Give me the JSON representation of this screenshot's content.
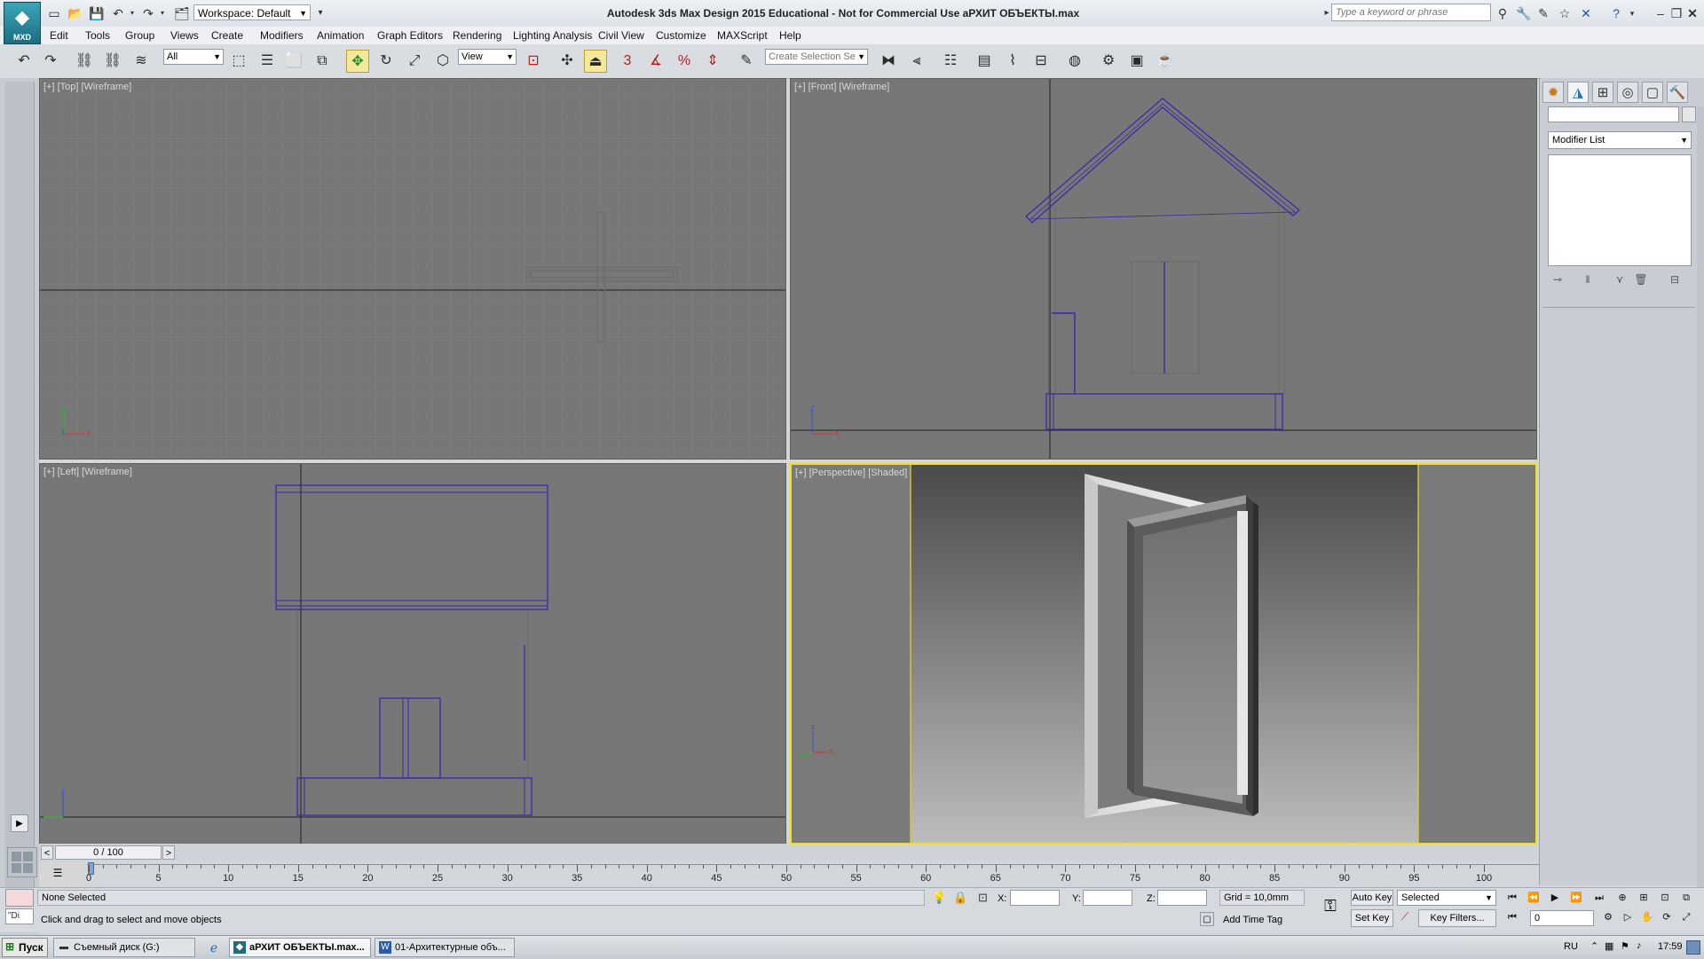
{
  "app": {
    "logo_text": "MXD",
    "workspace": "Workspace: Default",
    "title": "Autodesk 3ds Max Design 2015  Educational - Not for Commercial Use    аРХИТ ОБЪЕКТЫ.max",
    "search_placeholder": "Type a keyword or phrase"
  },
  "menu": [
    "Edit",
    "Tools",
    "Group",
    "Views",
    "Create",
    "Modifiers",
    "Animation",
    "Graph Editors",
    "Rendering",
    "Lighting Analysis",
    "Civil View",
    "Customize",
    "MAXScript",
    "Help"
  ],
  "toolbar": {
    "selection_filter": "All",
    "ref_coord": "View",
    "named_selection": "Create Selection Se",
    "snap_3": "3"
  },
  "viewports": {
    "top": "[+] [Top] [Wireframe]",
    "front": "[+] [Front] [Wireframe]",
    "left": "[+] [Left] [Wireframe]",
    "perspective": "[+] [Perspective] [Shaded]"
  },
  "axes": {
    "x": "x",
    "y": "y",
    "z": "z"
  },
  "command_panel": {
    "modifier_list": "Modifier List"
  },
  "timeline": {
    "frame_display": "0 / 100",
    "prev": "<",
    "next": ">",
    "ticks": [
      "0",
      "5",
      "10",
      "15",
      "20",
      "25",
      "30",
      "35",
      "40",
      "45",
      "50",
      "55",
      "60",
      "65",
      "70",
      "75",
      "80",
      "85",
      "90",
      "95",
      "100"
    ]
  },
  "status": {
    "maxscript": "\"Di",
    "selection": "None Selected",
    "prompt": "Click and drag to select and move objects",
    "x_label": "X:",
    "y_label": "Y:",
    "z_label": "Z:",
    "grid": "Grid = 10,0mm",
    "add_time_tag": "Add Time Tag",
    "auto_key": "Auto Key",
    "set_key": "Set Key",
    "selected": "Selected",
    "key_filters": "Key Filters...",
    "frame": "0"
  },
  "taskbar": {
    "start": "Пуск",
    "tasks": [
      "Съемный диск (G:)",
      "аРХИТ ОБЪЕКТЫ.max...",
      "01-Архитектурные объ..."
    ],
    "lang": "RU",
    "clock": "17:59"
  },
  "colors": {
    "viewport_bg": "#777777",
    "wire": "#3a2aa8",
    "active_border": "#f0e01a"
  }
}
